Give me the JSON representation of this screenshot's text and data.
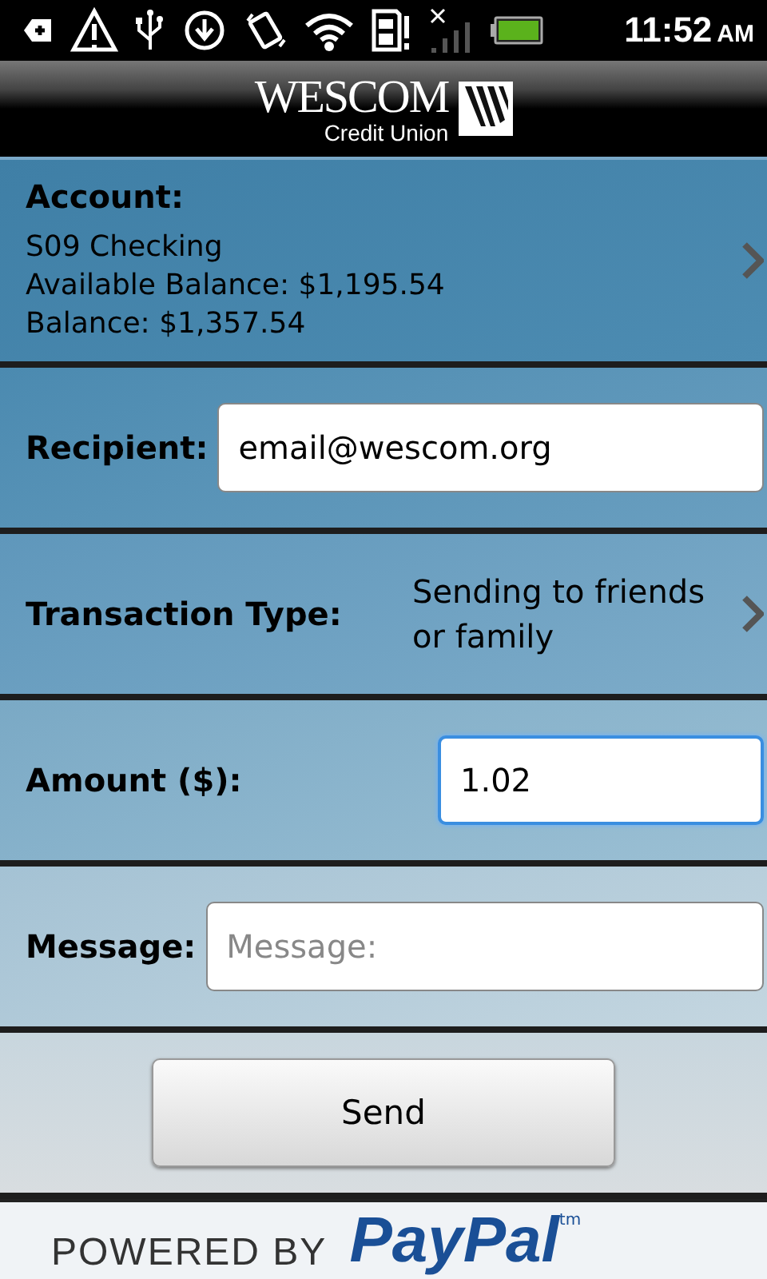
{
  "status_bar": {
    "time": "11:52",
    "meridiem": "AM"
  },
  "header": {
    "logo_name": "WESCOM",
    "logo_sub": "Credit Union"
  },
  "account": {
    "label": "Account:",
    "lines": [
      "S09 Checking",
      "Available Balance: $1,195.54",
      "Balance: $1,357.54"
    ]
  },
  "fields": [
    {
      "kind": "text",
      "label": "Recipient:",
      "value": "email@wescom.org",
      "focused": false
    },
    {
      "kind": "choice",
      "label": "Transaction Type:",
      "value": "Sending to friends or family"
    },
    {
      "kind": "short_text",
      "label": "Amount ($):",
      "value": "1.02",
      "focused": true
    },
    {
      "kind": "text",
      "label": "Message:",
      "placeholder": "Message:",
      "focused": false
    }
  ],
  "send_button": "Send",
  "footer": {
    "powered": "POWERED BY",
    "brand": "PayPal",
    "tm": "tm"
  }
}
